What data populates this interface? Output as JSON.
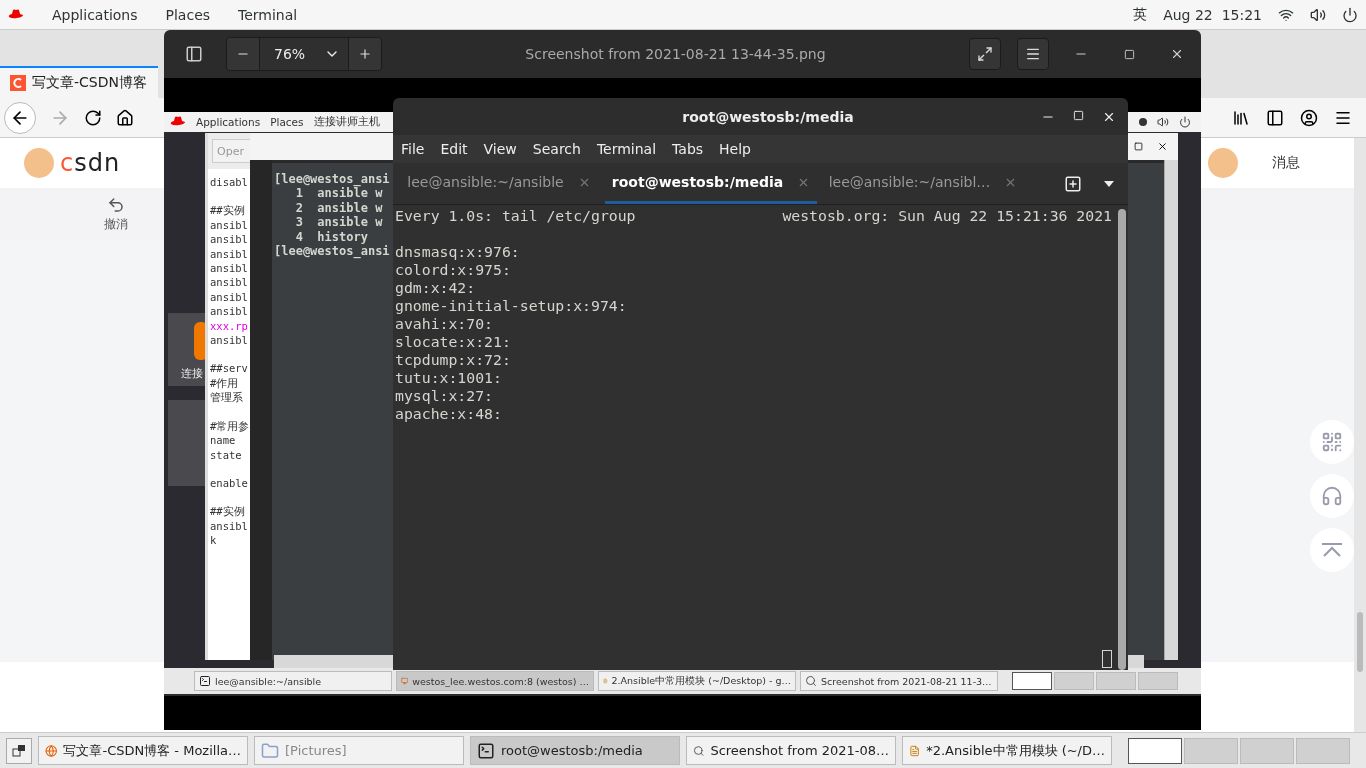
{
  "top_bar": {
    "menus": [
      "Applications",
      "Places",
      "Terminal"
    ],
    "input_method": "英",
    "clock": "Aug 22  15:21"
  },
  "browser": {
    "tab_title": "写文章-CSDN博客",
    "logo_text": "csdn",
    "undo_label": "撤消",
    "messages_label": "消息"
  },
  "image_viewer": {
    "zoom": "76%",
    "title": "Screenshot from 2021-08-21 13-44-35.png",
    "image": {
      "menus": [
        "Applications",
        "Places",
        "连接讲师主机"
      ],
      "desktop_label": "连接",
      "editor_button": "Oper",
      "editor_groups": [
        [
          {
            "text": "disabl",
            "kind": "plain"
          }
        ],
        [
          {
            "text": "##实例",
            "kind": "plain"
          },
          {
            "text": "ansibl",
            "kind": "plain"
          },
          {
            "text": "ansibl",
            "kind": "plain"
          },
          {
            "text": "ansibl",
            "kind": "plain"
          },
          {
            "text": "ansibl",
            "kind": "plain"
          },
          {
            "text": "ansibl",
            "kind": "plain"
          },
          {
            "text": "ansibl",
            "kind": "plain"
          },
          {
            "text": "ansibl",
            "kind": "plain"
          },
          {
            "text": "xxx.rp",
            "kind": "highlight"
          },
          {
            "text": "ansibl",
            "kind": "plain"
          }
        ],
        [
          {
            "text": "##serv",
            "kind": "plain"
          },
          {
            "text": "#作用",
            "kind": "plain"
          },
          {
            "text": "管理系",
            "kind": "plain"
          }
        ],
        [
          {
            "text": "#常用参",
            "kind": "plain"
          },
          {
            "text": "name",
            "kind": "plain"
          },
          {
            "text": "state",
            "kind": "plain"
          }
        ],
        [
          {
            "text": "enable",
            "kind": "plain"
          }
        ],
        [
          {
            "text": "##实例",
            "kind": "plain"
          },
          {
            "text": "ansibl",
            "kind": "plain"
          },
          {
            "text": "k",
            "kind": "plain"
          }
        ]
      ],
      "terminal_lines": [
        "[lee@westos_ansi",
        "   1  ansible w",
        "   2  ansible w",
        "   3  ansible w",
        "   4  history",
        "[lee@westos_ansi"
      ],
      "taskbar_items": [
        {
          "label": "lee@ansible:~/ansible",
          "kind": "terminal",
          "selected": false
        },
        {
          "label": "westos_lee.westos.com:8 (westos) …",
          "kind": "remote",
          "selected": true
        },
        {
          "label": "2.Ansible中常用模块 (~/Desktop) - g…",
          "kind": "editor",
          "selected": false
        },
        {
          "label": "Screenshot from 2021-08-21 11-3…",
          "kind": "viewer",
          "selected": false
        }
      ],
      "workspaces": [
        {
          "selected": true
        },
        {
          "selected": false
        },
        {
          "selected": false
        },
        {
          "selected": false
        }
      ]
    }
  },
  "terminal": {
    "title": "root@westosb:/media",
    "menus": [
      "File",
      "Edit",
      "View",
      "Search",
      "Terminal",
      "Tabs",
      "Help"
    ],
    "tabs": [
      {
        "label": "lee@ansible:~/ansible",
        "selected": false
      },
      {
        "label": "root@westosb:/media",
        "selected": true
      },
      {
        "label": "lee@ansible:~/ansibl…",
        "selected": false
      }
    ],
    "header_left": "Every 1.0s: tail /etc/group",
    "header_right": "westosb.org: Sun Aug 22 15:21:36 2021",
    "lines": [
      "dnsmasq:x:976:",
      "colord:x:975:",
      "gdm:x:42:",
      "gnome-initial-setup:x:974:",
      "avahi:x:70:",
      "slocate:x:21:",
      "tcpdump:x:72:",
      "tutu:x:1001:",
      "mysql:x:27:",
      "apache:x:48:"
    ]
  },
  "taskbar": {
    "items": [
      {
        "label": "写文章-CSDN博客 - Mozilla…",
        "kind": "browser",
        "selected": false,
        "minimized": false
      },
      {
        "label": "[Pictures]",
        "kind": "files",
        "selected": false,
        "minimized": true
      },
      {
        "label": "root@westosb:/media",
        "kind": "terminal",
        "selected": true,
        "minimized": false
      },
      {
        "label": "Screenshot from 2021-08…",
        "kind": "viewer",
        "selected": false,
        "minimized": false
      },
      {
        "label": "*2.Ansible中常用模块 (~/D…",
        "kind": "editor",
        "selected": false,
        "minimized": false
      }
    ],
    "workspaces": [
      {
        "selected": true
      },
      {
        "selected": false
      },
      {
        "selected": false
      },
      {
        "selected": false
      }
    ]
  }
}
